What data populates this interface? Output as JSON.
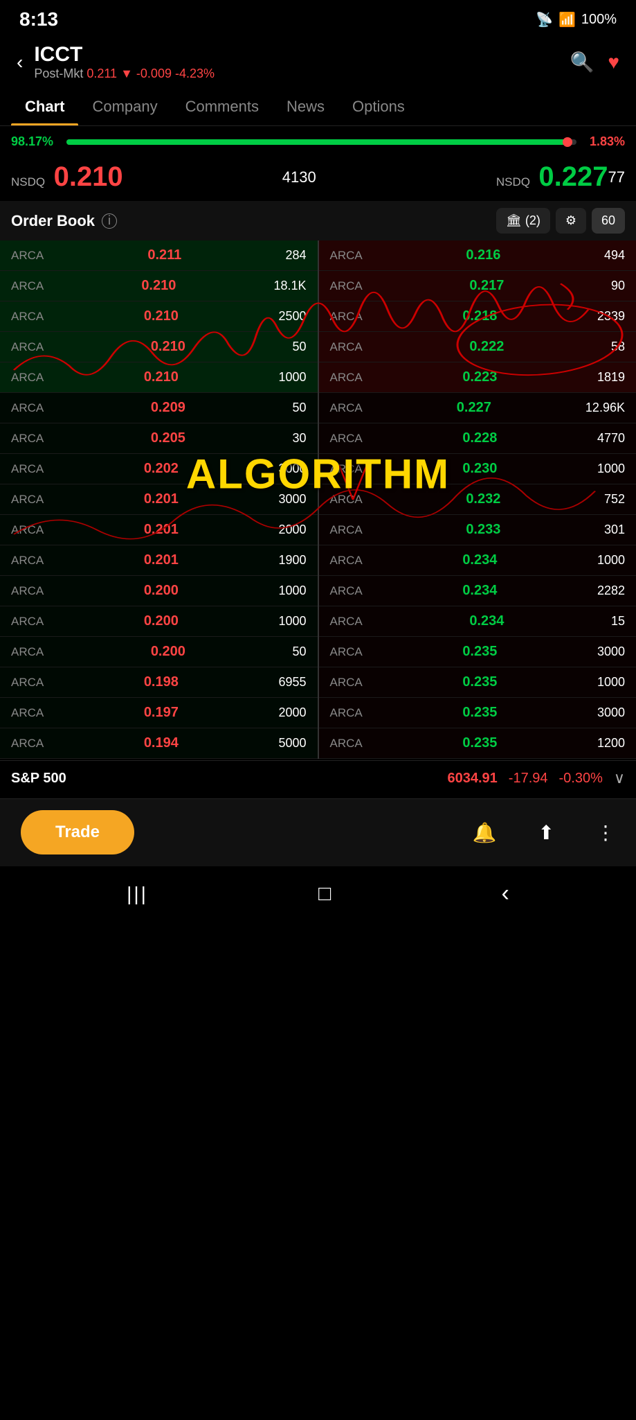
{
  "statusBar": {
    "time": "8:13",
    "battery": "100%"
  },
  "header": {
    "symbol": "ICCT",
    "marketLabel": "Post-Mkt",
    "price": "0.211",
    "change": "-0.009",
    "changePct": "-4.23%",
    "backLabel": "‹",
    "searchIcon": "🔍",
    "favoriteIcon": "♥"
  },
  "tabs": [
    {
      "id": "chart",
      "label": "Chart",
      "active": true
    },
    {
      "id": "company",
      "label": "Company",
      "active": false
    },
    {
      "id": "comments",
      "label": "Comments",
      "active": false
    },
    {
      "id": "news",
      "label": "News",
      "active": false
    },
    {
      "id": "options",
      "label": "Options",
      "active": false
    }
  ],
  "progressBar": {
    "leftPct": "98.17%",
    "rightPct": "1.83%",
    "fillWidth": "98.17"
  },
  "priceRows": {
    "bid": {
      "exchange": "NSDQ",
      "price": "0.210",
      "volume": "4130"
    },
    "ask": {
      "exchange": "NSDQ",
      "price": "0.227",
      "volume": "77"
    }
  },
  "orderBook": {
    "title": "Order Book",
    "bankBtnLabel": "🏛 (2)",
    "filterBtnLabel": "⚙",
    "numBtnLabel": "60",
    "bids": [
      {
        "exchange": "ARCA",
        "price": "0.211",
        "qty": "284"
      },
      {
        "exchange": "ARCA",
        "price": "0.210",
        "qty": "18.1K"
      },
      {
        "exchange": "ARCA",
        "price": "0.210",
        "qty": "2500"
      },
      {
        "exchange": "ARCA",
        "price": "0.210",
        "qty": "50"
      },
      {
        "exchange": "ARCA",
        "price": "0.210",
        "qty": "1000"
      },
      {
        "exchange": "ARCA",
        "price": "0.209",
        "qty": "50"
      },
      {
        "exchange": "ARCA",
        "price": "0.205",
        "qty": "30"
      },
      {
        "exchange": "ARCA",
        "price": "0.202",
        "qty": "3000"
      },
      {
        "exchange": "ARCA",
        "price": "0.201",
        "qty": "3000"
      },
      {
        "exchange": "ARCA",
        "price": "0.201",
        "qty": "2000"
      },
      {
        "exchange": "ARCA",
        "price": "0.201",
        "qty": "1900"
      },
      {
        "exchange": "ARCA",
        "price": "0.200",
        "qty": "1000"
      },
      {
        "exchange": "ARCA",
        "price": "0.200",
        "qty": "1000"
      },
      {
        "exchange": "ARCA",
        "price": "0.200",
        "qty": "50"
      },
      {
        "exchange": "ARCA",
        "price": "0.198",
        "qty": "6955"
      },
      {
        "exchange": "ARCA",
        "price": "0.197",
        "qty": "2000"
      },
      {
        "exchange": "ARCA",
        "price": "0.194",
        "qty": "5000"
      }
    ],
    "asks": [
      {
        "exchange": "ARCA",
        "price": "0.216",
        "qty": "494"
      },
      {
        "exchange": "ARCA",
        "price": "0.217",
        "qty": "90"
      },
      {
        "exchange": "ARCA",
        "price": "0.218",
        "qty": "2339"
      },
      {
        "exchange": "ARCA",
        "price": "0.222",
        "qty": "58"
      },
      {
        "exchange": "ARCA",
        "price": "0.223",
        "qty": "1819"
      },
      {
        "exchange": "ARCA",
        "price": "0.227",
        "qty": "12.96K"
      },
      {
        "exchange": "ARCA",
        "price": "0.228",
        "qty": "4770"
      },
      {
        "exchange": "ARCA",
        "price": "0.230",
        "qty": "1000"
      },
      {
        "exchange": "ARCA",
        "price": "0.232",
        "qty": "752"
      },
      {
        "exchange": "ARCA",
        "price": "0.233",
        "qty": "301"
      },
      {
        "exchange": "ARCA",
        "price": "0.234",
        "qty": "1000"
      },
      {
        "exchange": "ARCA",
        "price": "0.234",
        "qty": "2282"
      },
      {
        "exchange": "ARCA",
        "price": "0.234",
        "qty": "15"
      },
      {
        "exchange": "ARCA",
        "price": "0.235",
        "qty": "3000"
      },
      {
        "exchange": "ARCA",
        "price": "0.235",
        "qty": "1000"
      },
      {
        "exchange": "ARCA",
        "price": "0.235",
        "qty": "3000"
      },
      {
        "exchange": "ARCA",
        "price": "0.235",
        "qty": "1200"
      }
    ],
    "watermark": "ALGORITHM"
  },
  "sp500": {
    "label": "S&P 500",
    "price": "6034.91",
    "change": "-17.94",
    "changePct": "-0.30%"
  },
  "actionBar": {
    "tradeBtnLabel": "Trade",
    "alertIcon": "🔔",
    "shareIcon": "⬆",
    "moreIcon": "⋮"
  },
  "navBar": {
    "menuIcon": "|||",
    "homeIcon": "□",
    "backIcon": "‹"
  }
}
